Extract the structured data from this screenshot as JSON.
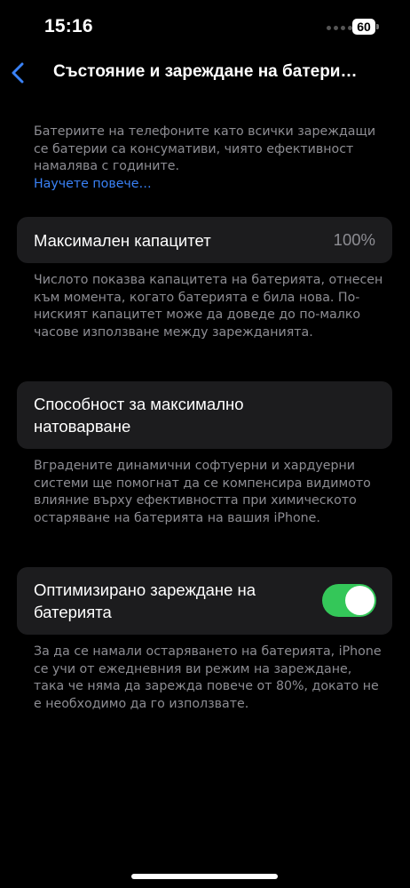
{
  "status_bar": {
    "time": "15:16",
    "battery": "60"
  },
  "nav": {
    "title": "Състояние и зареждане на батери…"
  },
  "intro": {
    "text": "Батериите на телефоните като всички зареждащи се батерии са консумативи, чиято ефективност намалява с годините.",
    "link": "Научете повече…"
  },
  "max_capacity": {
    "label": "Максимален капацитет",
    "value": "100%",
    "footer": "Числото показва капацитета на батерията, отнесен към момента, когато батерията е била нова. По-ниският капацитет може да доведе до по-малко часове използване между зарежданията."
  },
  "peak_performance": {
    "label": "Способност за максимално натоварване",
    "footer": "Вградените динамични софтуерни и хардуерни системи ще помогнат да се компенсира видимото влияние върху ефективността при химическото остаряване на батерията на вашия iPhone."
  },
  "optimized_charging": {
    "label": "Оптимизирано зареждане на батерията",
    "enabled": true,
    "footer": "За да се намали остаряването на батерията, iPhone се учи от ежедневния ви режим на зареждане, така че няма да зарежда повече от 80%, докато не е необходимо да го използвате."
  },
  "colors": {
    "accent": "#3a82f7",
    "toggle_on": "#34c759",
    "card": "#1c1c1e"
  }
}
